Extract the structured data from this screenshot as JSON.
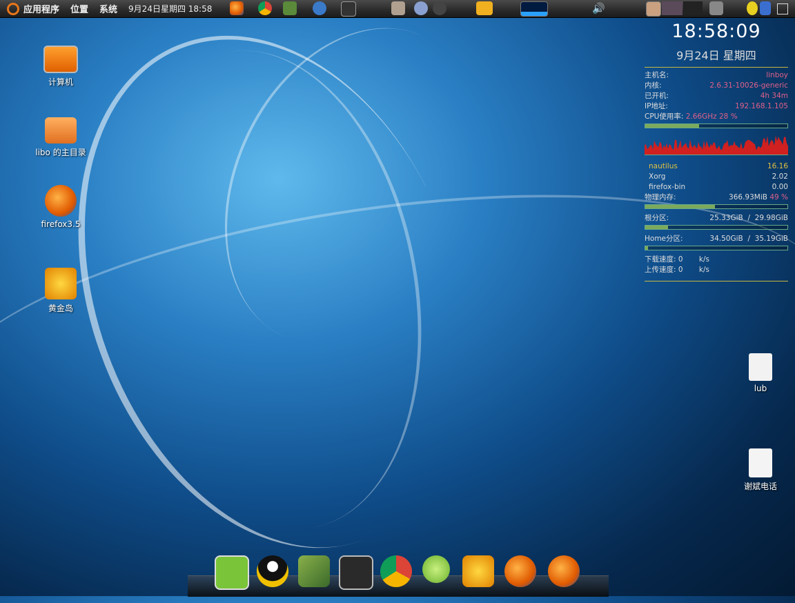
{
  "panel": {
    "menus": [
      "应用程序",
      "位置",
      "系统"
    ],
    "clock": "9月24日星期四 18:58"
  },
  "desktop_icons": [
    {
      "label": "计算机",
      "icon": "computer-icon"
    },
    {
      "label": "libo 的主目录",
      "icon": "home-folder-icon"
    },
    {
      "label": "firefox3.5",
      "icon": "firefox-icon"
    },
    {
      "label": "黄金岛",
      "icon": "game-icon"
    },
    {
      "label": "lub",
      "icon": "document-icon"
    },
    {
      "label": "谢斌电话",
      "icon": "text-file-icon"
    }
  ],
  "conky": {
    "time": "18:58:09",
    "date": "9月24日 星期四",
    "info": [
      {
        "label": "主机名:",
        "value": "linboy"
      },
      {
        "label": "内核:",
        "value": "2.6.31-10026-generic"
      },
      {
        "label": "已开机:",
        "value": "4h 34m"
      },
      {
        "label": "IP地址:",
        "value": "192.168.1.105"
      }
    ],
    "cpu_label": "CPU使用率:",
    "cpu_value": "2.66GHz 28 %",
    "cpu_percent": 38,
    "processes": [
      {
        "name": "nautilus",
        "value": "16.16"
      },
      {
        "name": "Xorg",
        "value": "2.02"
      },
      {
        "name": "firefox-bin",
        "value": "0.00"
      }
    ],
    "mem_label": "物理内存:",
    "mem_value": "366.93MiB",
    "mem_percent_text": "49 %",
    "mem_percent": 49,
    "root_label": "根分区:",
    "root_used": "25.33GiB",
    "root_total": "29.98GiB",
    "root_percent": 16,
    "home_label": "Home分区:",
    "home_used": "34.50GiB",
    "home_total": "35.19GiB",
    "home_percent": 2,
    "down_label": "下载速度:",
    "down_value": "0",
    "up_label": "上传速度:",
    "up_value": "0",
    "speed_unit": "k/s",
    "slash": "/"
  },
  "dock_items": [
    "ubuntu-software-icon",
    "qq-penguin-icon",
    "book-icon",
    "terminal-icon",
    "chrome-icon",
    "media-player-icon",
    "game-icon",
    "firefox-icon",
    "firefox-icon"
  ],
  "colors": {
    "accent_pink": "#e0608a",
    "accent_yellow": "#e0c040",
    "bar_fill": "#7caa5c"
  }
}
